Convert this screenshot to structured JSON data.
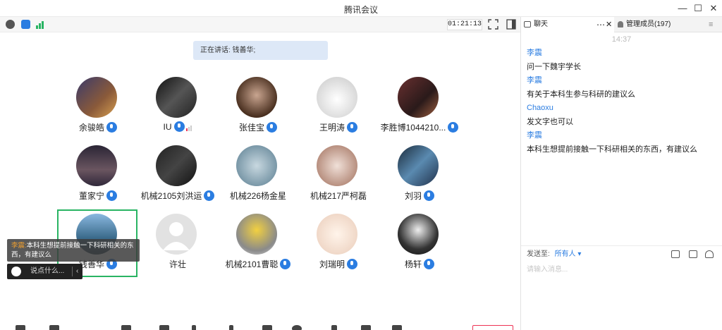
{
  "window": {
    "title": "腾讯会议"
  },
  "toolbar": {
    "timer": "01:21:13"
  },
  "stage": {
    "speaking": "正在讲话: 钱善华;",
    "participants": [
      {
        "name": "余骏皓",
        "mic": true
      },
      {
        "name": "IU",
        "mic": true,
        "signal": true
      },
      {
        "name": "张佳宝",
        "mic": true
      },
      {
        "name": "王明涛",
        "mic": true
      },
      {
        "name": "李胜博1044210...",
        "mic": true
      },
      {
        "name": "董家宁",
        "mic": true
      },
      {
        "name": "机械2105刘洪运",
        "mic": true
      },
      {
        "name": "机械226杨金星",
        "mic": false
      },
      {
        "name": "机械217严柯磊",
        "mic": false
      },
      {
        "name": "刘羽",
        "mic": true
      },
      {
        "name": "钱善华",
        "mic": true
      },
      {
        "name": "许壮",
        "mic": false
      },
      {
        "name": "机械2101曹聪",
        "mic": true
      },
      {
        "name": "刘瑞明",
        "mic": true
      },
      {
        "name": "杨轩",
        "mic": true
      }
    ],
    "toast": {
      "sender": "李震:",
      "text": "本科生想提前接触一下科研相关的东西，有建议么"
    },
    "say_placeholder": "说点什么..."
  },
  "panel": {
    "tab_chat": "聊天",
    "tab_members": "管理成员(197)",
    "time": "14:37",
    "messages": [
      {
        "sender": "李震",
        "text": "问一下魏宇学长"
      },
      {
        "sender": "李震",
        "text": "有关于本科生参与科研的建议么"
      },
      {
        "sender": "Chaoxu",
        "text": "发文字也可以"
      },
      {
        "sender": "李震",
        "text": "本科生想提前接触一下科研相关的东西，有建议么"
      }
    ],
    "send_label": "发送至:",
    "send_target": "所有人 ▾",
    "input_placeholder": "请输入消息..."
  },
  "colors": {
    "accent": "#2b7de1",
    "active_speaker": "#29b463"
  }
}
